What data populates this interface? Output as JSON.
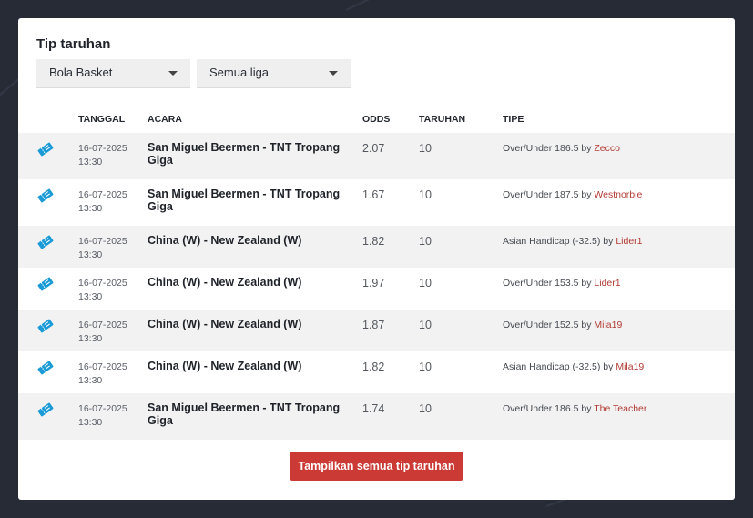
{
  "panel": {
    "title": "Tip taruhan"
  },
  "filters": {
    "sport": "Bola Basket",
    "league": "Semua liga"
  },
  "columns": {
    "date": "TANGGAL",
    "event": "ACARA",
    "odds": "ODDS",
    "stake": "TARUHAN",
    "type": "TIPE"
  },
  "tips": [
    {
      "date": "16-07-2025",
      "time": "13:30",
      "event": "San Miguel Beermen - TNT Tropang Giga",
      "odds": "2.07",
      "stake": "10",
      "type": "Over/Under 186.5 by ",
      "user": "Zecco"
    },
    {
      "date": "16-07-2025",
      "time": "13:30",
      "event": "San Miguel Beermen - TNT Tropang Giga",
      "odds": "1.67",
      "stake": "10",
      "type": "Over/Under 187.5 by ",
      "user": "Westnorbie"
    },
    {
      "date": "16-07-2025",
      "time": "13:30",
      "event": "China (W) - New Zealand (W)",
      "odds": "1.82",
      "stake": "10",
      "type": "Asian Handicap (-32.5) by ",
      "user": "Lider1"
    },
    {
      "date": "16-07-2025",
      "time": "13:30",
      "event": "China (W) - New Zealand (W)",
      "odds": "1.97",
      "stake": "10",
      "type": "Over/Under 153.5 by ",
      "user": "Lider1"
    },
    {
      "date": "16-07-2025",
      "time": "13:30",
      "event": "China (W) - New Zealand (W)",
      "odds": "1.87",
      "stake": "10",
      "type": "Over/Under 152.5 by ",
      "user": "Mila19"
    },
    {
      "date": "16-07-2025",
      "time": "13:30",
      "event": "China (W) - New Zealand (W)",
      "odds": "1.82",
      "stake": "10",
      "type": "Asian Handicap (-32.5) by ",
      "user": "Mila19"
    },
    {
      "date": "16-07-2025",
      "time": "13:30",
      "event": "San Miguel Beermen - TNT Tropang Giga",
      "odds": "1.74",
      "stake": "10",
      "type": "Over/Under 186.5 by ",
      "user": "The Teacher"
    }
  ],
  "actions": {
    "show_all": "Tampilkan semua tip taruhan"
  },
  "icons": {
    "row_icon": "ticket-icon"
  },
  "colors": {
    "accent": "#cb3a34",
    "icon": "#1a9bd7",
    "user_link": "#b23b34"
  }
}
